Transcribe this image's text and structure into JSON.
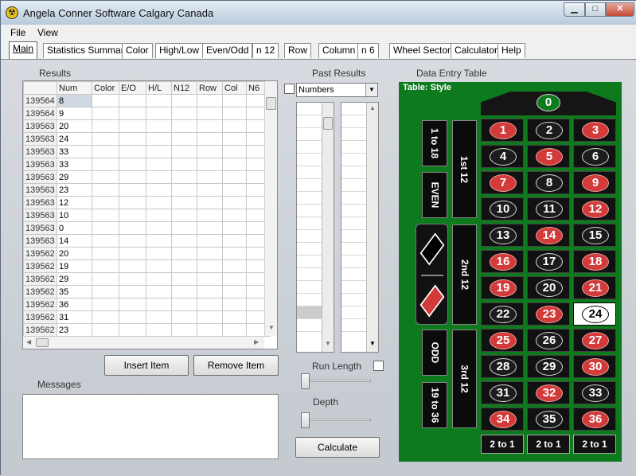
{
  "window": {
    "title": "Angela Conner Software  Calgary Canada",
    "icon": "radiation-icon"
  },
  "menu": [
    "File",
    "View"
  ],
  "tabs": [
    "Main",
    "Statistics Summary",
    "Color",
    "High/Low",
    "Even/Odd",
    "n 12",
    "Row",
    "Column",
    "n 6",
    "Wheel Sector",
    "Calculator",
    "Help"
  ],
  "results": {
    "label": "Results",
    "columns": [
      "Num",
      "Color",
      "E/O",
      "H/L",
      "N12",
      "Row",
      "Col",
      "N6"
    ],
    "rows": [
      {
        "id": "139564",
        "num": "8"
      },
      {
        "id": "139564",
        "num": "9"
      },
      {
        "id": "139563",
        "num": "20"
      },
      {
        "id": "139563",
        "num": "24"
      },
      {
        "id": "139563",
        "num": "33"
      },
      {
        "id": "139563",
        "num": "33"
      },
      {
        "id": "139563",
        "num": "29"
      },
      {
        "id": "139563",
        "num": "23"
      },
      {
        "id": "139563",
        "num": "12"
      },
      {
        "id": "139563",
        "num": "10"
      },
      {
        "id": "139563",
        "num": "0"
      },
      {
        "id": "139563",
        "num": "14"
      },
      {
        "id": "139562",
        "num": "20"
      },
      {
        "id": "139562",
        "num": "19"
      },
      {
        "id": "139562",
        "num": "29"
      },
      {
        "id": "139562",
        "num": "35"
      },
      {
        "id": "139562",
        "num": "36"
      },
      {
        "id": "139562",
        "num": "31"
      },
      {
        "id": "139562",
        "num": "23"
      }
    ]
  },
  "buttons": {
    "insert": "Insert Item",
    "remove": "Remove Item",
    "calculate": "Calculate"
  },
  "messages": {
    "label": "Messages"
  },
  "past": {
    "label": "Past Results",
    "dropdown": "Numbers",
    "run_length": "Run Length",
    "depth": "Depth"
  },
  "table": {
    "group_label": "Data Entry Table",
    "style_label": "Table: Style",
    "zero": "0",
    "numbers": [
      [
        "1",
        "red"
      ],
      [
        "2",
        "black"
      ],
      [
        "3",
        "red"
      ],
      [
        "4",
        "black"
      ],
      [
        "5",
        "red"
      ],
      [
        "6",
        "black"
      ],
      [
        "7",
        "red"
      ],
      [
        "8",
        "black"
      ],
      [
        "9",
        "red"
      ],
      [
        "10",
        "black"
      ],
      [
        "11",
        "black"
      ],
      [
        "12",
        "red"
      ],
      [
        "13",
        "black"
      ],
      [
        "14",
        "red"
      ],
      [
        "15",
        "black"
      ],
      [
        "16",
        "red"
      ],
      [
        "17",
        "black"
      ],
      [
        "18",
        "red"
      ],
      [
        "19",
        "red"
      ],
      [
        "20",
        "black"
      ],
      [
        "21",
        "red"
      ],
      [
        "22",
        "black"
      ],
      [
        "23",
        "red"
      ],
      [
        "24",
        "black"
      ],
      [
        "25",
        "red"
      ],
      [
        "26",
        "black"
      ],
      [
        "27",
        "red"
      ],
      [
        "28",
        "black"
      ],
      [
        "29",
        "black"
      ],
      [
        "30",
        "red"
      ],
      [
        "31",
        "black"
      ],
      [
        "32",
        "red"
      ],
      [
        "33",
        "black"
      ],
      [
        "34",
        "red"
      ],
      [
        "35",
        "black"
      ],
      [
        "36",
        "red"
      ]
    ],
    "selected": "24",
    "dozens": [
      "1st 12",
      "2nd 12",
      "3rd 12"
    ],
    "outside": [
      "1 to 18",
      "EVEN",
      "ODD",
      "19 to 36"
    ],
    "column_bets": [
      "2 to 1",
      "2 to 1",
      "2 to 1"
    ],
    "colors": {
      "felt": "#0d7a1e",
      "red": "#d33a3a",
      "black": "#1c1c1c"
    }
  }
}
